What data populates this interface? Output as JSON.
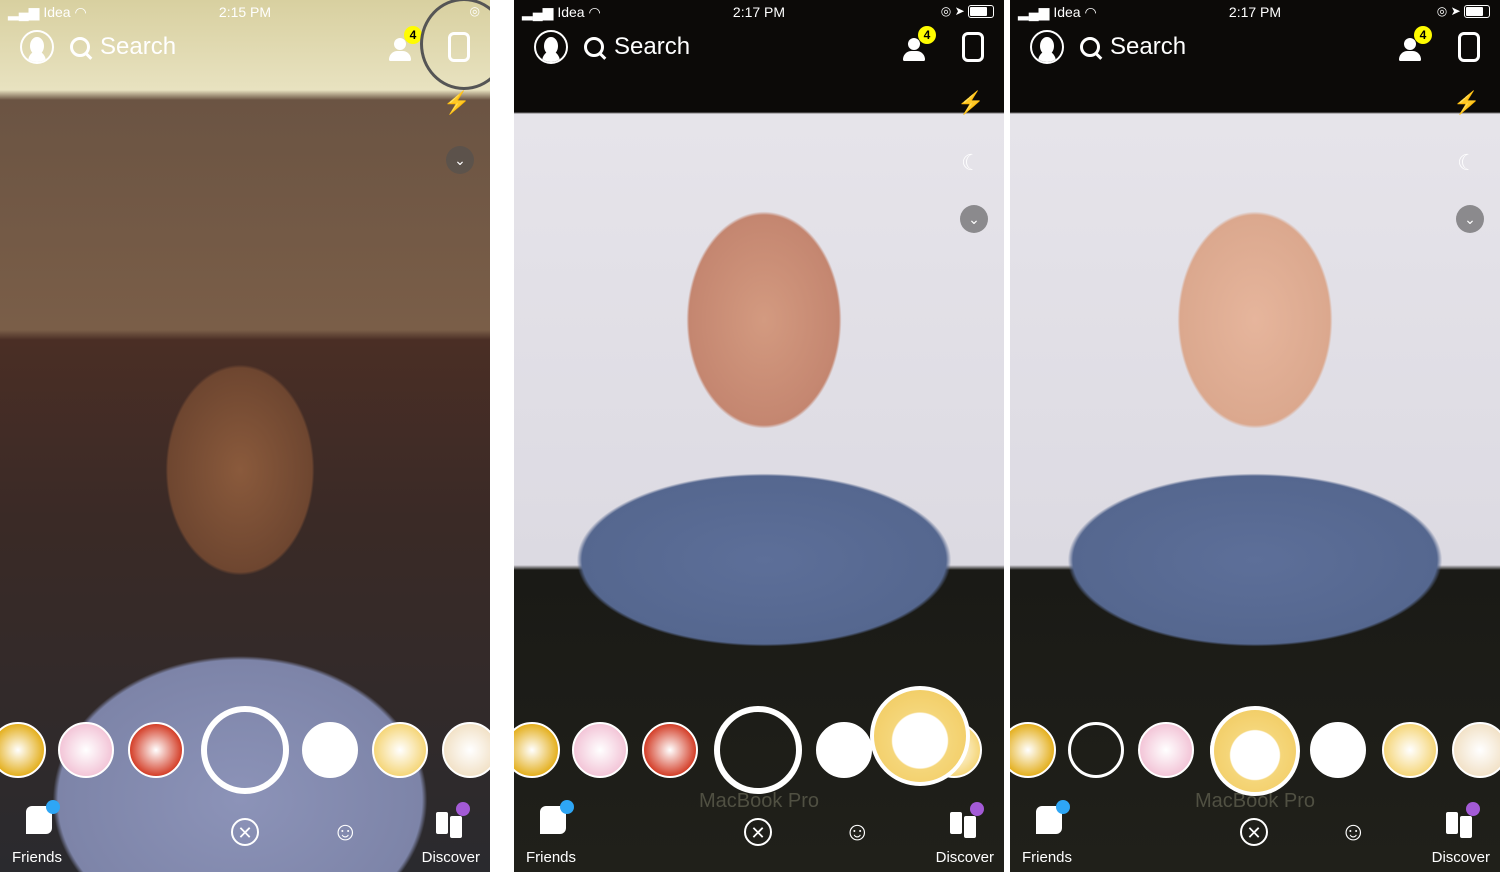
{
  "panels": [
    {
      "carrier": "Idea",
      "time": "2:15 PM",
      "search": "Search",
      "badge": "4",
      "friends": "Friends",
      "discover": "Discover",
      "watermark": "",
      "flip_highlighted": true,
      "has_moon": false,
      "selected_lens": false
    },
    {
      "carrier": "Idea",
      "time": "2:17 PM",
      "search": "Search",
      "badge": "4",
      "friends": "Friends",
      "discover": "Discover",
      "watermark": "MacBook Pro",
      "flip_highlighted": false,
      "has_moon": true,
      "selected_lens": true
    },
    {
      "carrier": "Idea",
      "time": "2:17 PM",
      "search": "Search",
      "badge": "4",
      "friends": "Friends",
      "discover": "Discover",
      "watermark": "MacBook Pro",
      "flip_highlighted": false,
      "has_moon": true,
      "selected_lens": true
    }
  ],
  "icons": {
    "signal": "signal-icon",
    "wifi": "wifi-icon",
    "flash": "flash-off-icon",
    "night": "moon-icon",
    "more": "chevron-down-icon",
    "cancel": "close-icon",
    "lens_explorer": "lens-explorer-icon",
    "friends": "chat-icon",
    "discover": "discover-icon"
  },
  "colors": {
    "badge": "#fffc00",
    "friends_dot": "#2ea6f5",
    "discover_dot": "#a35ad6"
  },
  "lens_colors": [
    "#e4b020",
    "#f3c6d8",
    "#d4402a",
    "#ffffff",
    "#f5d67a",
    "#f2e2c8",
    "#e8c0a0"
  ]
}
